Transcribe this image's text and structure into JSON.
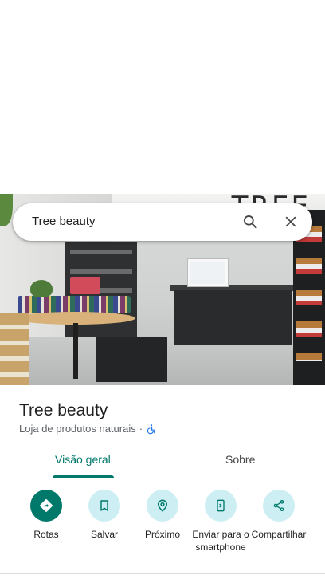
{
  "search": {
    "value": "Tree beauty"
  },
  "hero": {
    "sign_text": "TREE"
  },
  "place": {
    "name": "Tree beauty",
    "category": "Loja de produtos naturais",
    "separator": "·"
  },
  "tabs": [
    {
      "label": "Visão geral",
      "active": true
    },
    {
      "label": "Sobre",
      "active": false
    }
  ],
  "actions": [
    {
      "label": "Rotas",
      "icon": "directions-icon"
    },
    {
      "label": "Salvar",
      "icon": "bookmark-icon"
    },
    {
      "label": "Próximo",
      "icon": "nearby-icon"
    },
    {
      "label": "Enviar para o smartphone",
      "icon": "send-to-phone-icon"
    },
    {
      "label": "Compartilhar",
      "icon": "share-icon"
    }
  ],
  "colors": {
    "accent": "#00796b",
    "chip_bg": "#cdeff4",
    "accessible_icon": "#1a73e8"
  }
}
